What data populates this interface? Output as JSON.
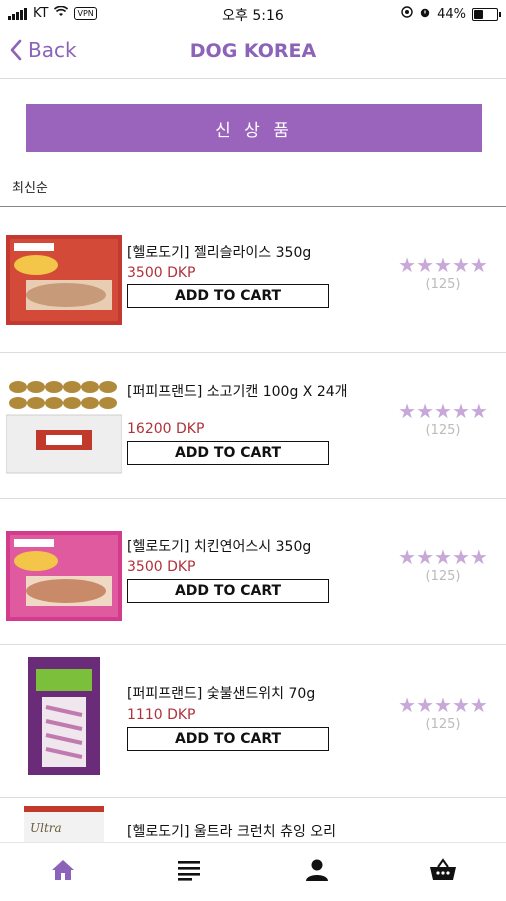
{
  "status_bar": {
    "carrier": "KT",
    "vpn": "VPN",
    "time": "오후 5:16",
    "battery": "44%",
    "battery_level": 0.44
  },
  "nav": {
    "back_label": "Back",
    "title": "DOG KOREA"
  },
  "new_products_button": "신 상 품",
  "sort_label": "최신순",
  "accent_color": "#9a63bc",
  "products": [
    {
      "name": "[헬로도기] 젤리슬라이스 350g",
      "price": "3500 DKP",
      "cart": "ADD TO CART",
      "stars": "★★★★★",
      "count": "(125)"
    },
    {
      "name": "[퍼피프랜드] 소고기캔 100g X 24개",
      "price": "16200 DKP",
      "cart": "ADD TO CART",
      "stars": "★★★★★",
      "count": "(125)"
    },
    {
      "name": "[헬로도기] 치킨연어스시 350g",
      "price": "3500 DKP",
      "cart": "ADD TO CART",
      "stars": "★★★★★",
      "count": "(125)"
    },
    {
      "name": "[퍼피프랜드] 숯불샌드위치 70g",
      "price": "1110 DKP",
      "cart": "ADD TO CART",
      "stars": "★★★★★",
      "count": "(125)"
    },
    {
      "name": "[헬로도기] 울트라 크런치 츄잉 오리"
    }
  ],
  "tabs": [
    {
      "icon": "home-icon"
    },
    {
      "icon": "list-icon"
    },
    {
      "icon": "user-icon"
    },
    {
      "icon": "basket-icon"
    }
  ]
}
